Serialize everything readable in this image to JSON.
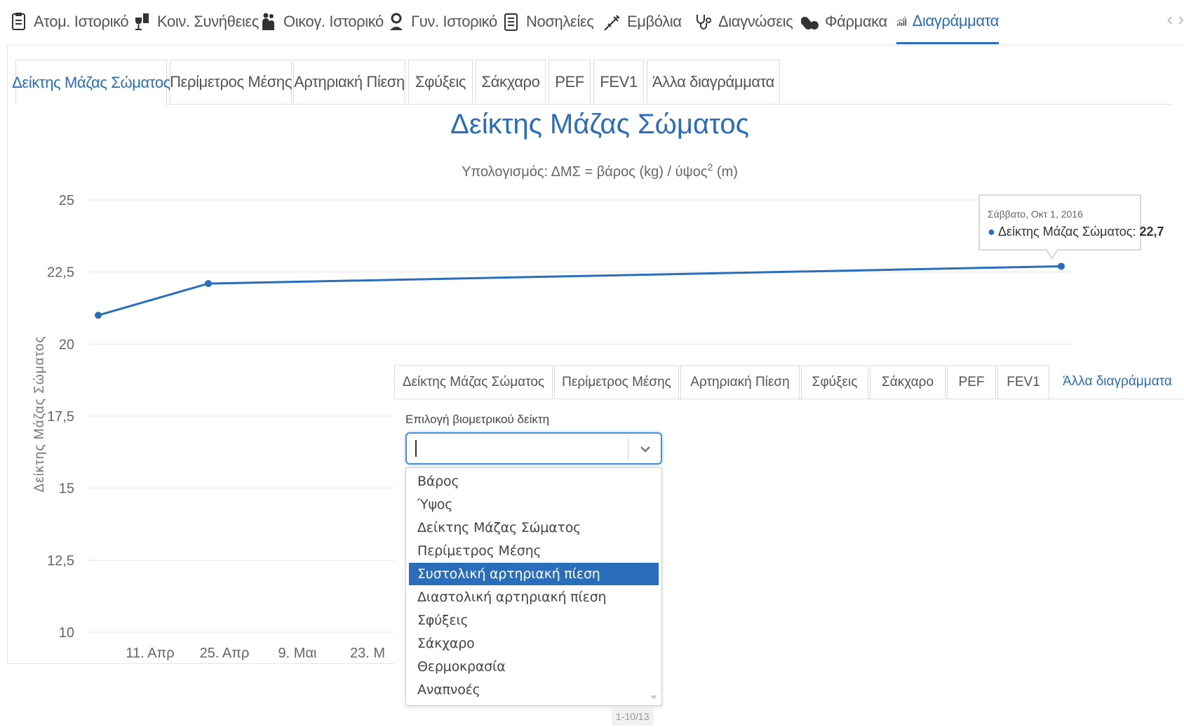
{
  "topnav": {
    "items": [
      {
        "label": "Ατομ. Ιστορικό",
        "icon": "file-icon"
      },
      {
        "label": "Κοιν. Συνήθειες",
        "icon": "wine-smoking-icon"
      },
      {
        "label": "Οικογ. Ιστορικό",
        "icon": "family-icon"
      },
      {
        "label": "Γυν. Ιστορικό",
        "icon": "female-icon"
      },
      {
        "label": "Νοσηλείες",
        "icon": "clipboard-icon"
      },
      {
        "label": "Εμβόλια",
        "icon": "syringe-icon"
      },
      {
        "label": "Διαγνώσεις",
        "icon": "stethoscope-icon"
      },
      {
        "label": "Φάρμακα",
        "icon": "pills-icon"
      },
      {
        "label": "Διαγράμματα",
        "icon": "chart-icon"
      }
    ],
    "active_index": 8,
    "arrows": "‹ ›"
  },
  "tabs": [
    "Δείκτης Μάζας Σώματος",
    "Περίμετρος Μέσης",
    "Αρτηριακή Πίεση",
    "Σφύξεις",
    "Σάκχαρο",
    "PEF",
    "FEV1",
    "Άλλα διαγράμματα"
  ],
  "chart_data": {
    "type": "line",
    "title": "Δείκτης Μάζας Σώματος",
    "subtitle": "Υπολογισμός: ΔΜΣ = βάρος (kg) / ύψος",
    "subtitle_sup": "2",
    "subtitle_tail": " (m)",
    "ylabel": "Δείκτης Μάζας Σώματος",
    "ylim": [
      10,
      25
    ],
    "yticks": [
      "25",
      "22,5",
      "20",
      "17,5",
      "15",
      "12,5",
      "10"
    ],
    "xticks": [
      "11. Απρ",
      "25. Απρ",
      "9. Μαι",
      "23. Μ"
    ],
    "series": [
      {
        "values": [
          21.0,
          22.1,
          22.7
        ]
      }
    ],
    "color": "#2a6ebb",
    "tooltip": {
      "date": "Σάββατο, Οκτ 1, 2016",
      "series_label": "Δείκτης Μάζας Σώματος",
      "value": "22,7"
    }
  },
  "overlay": {
    "tabs": [
      "Δείκτης Μάζας Σώματος",
      "Περίμετρος Μέσης",
      "Αρτηριακή Πίεση",
      "Σφύξεις",
      "Σάκχαρο",
      "PEF",
      "FEV1",
      "Άλλα διαγράμματα"
    ],
    "active_index": 7,
    "select_label": "Επιλογή βιομετρικού δείκτη",
    "select_value": "",
    "options": [
      "Βάρος",
      "Ύψος",
      "Δείκτης Μάζας Σώματος",
      "Περίμετρος Μέσης",
      "Συστολική αρτηριακή πίεση",
      "Διαστολική αρτηριακή πίεση",
      "Σφύξεις",
      "Σάκχαρο",
      "Θερμοκρασία",
      "Αναπνοές"
    ],
    "selected_option_index": 4,
    "pager": "1-10/13"
  }
}
